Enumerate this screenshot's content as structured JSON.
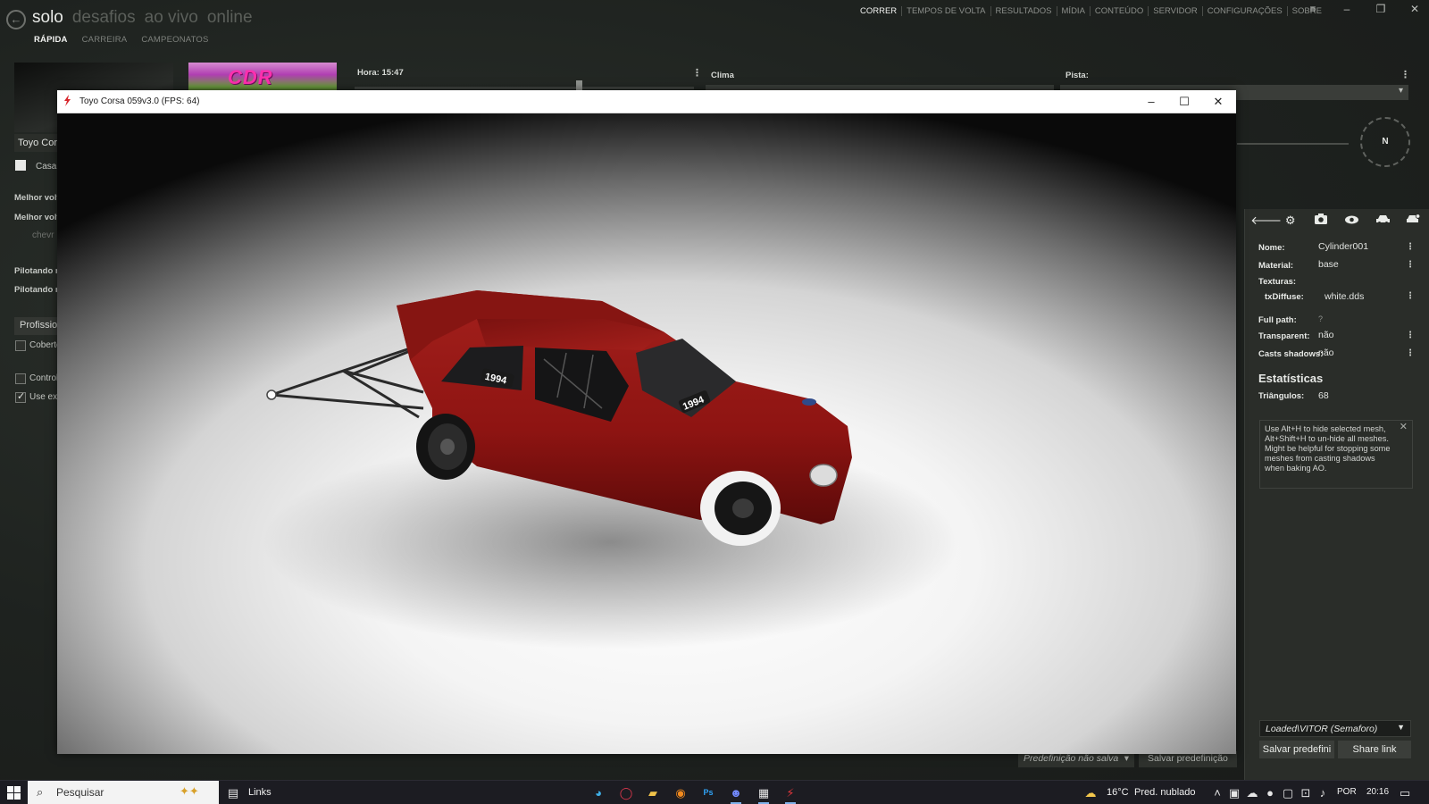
{
  "launcher": {
    "mode_tabs": [
      "solo",
      "desafios",
      "ao vivo",
      "online"
    ],
    "sub_tabs": [
      "RÁPIDA",
      "CARREIRA",
      "CAMPEONATOS"
    ],
    "top_nav": [
      "CORRER",
      "TEMPOS DE VOLTA",
      "RESULTADOS",
      "MÍDIA",
      "CONTEÚDO",
      "SERVIDOR",
      "CONFIGURAÇÕES",
      "SOBRE"
    ],
    "track_logo": "CDR",
    "time_label": "Hora: 15:47",
    "weather_label": "Clima",
    "track_label": "Pista:",
    "compass": "N",
    "car_name": "Toyo Cor",
    "skin_checkbox": "Casa",
    "best_lap_1": "Melhor volt",
    "best_lap_2": "Melhor volt",
    "car_dim": "chevr",
    "driving_1": "Pilotando n",
    "driving_2": "Pilotando n",
    "difficulty_btn": "Profissio",
    "covered_label": "Coberto",
    "controls_label": "Controle",
    "use_ext_label": "Use ext",
    "preset_status": "Predefinição não salva",
    "save_preset": "Salvar predefinição"
  },
  "viewer": {
    "title": "Toyo Corsa 059v3.0 (FPS: 64)",
    "car_decal": "1994",
    "colors": {
      "car_body": "#8e1412",
      "floor": "#ffffff"
    }
  },
  "inspector": {
    "fields": [
      {
        "label": "Nome:",
        "value": "Cylinder001"
      },
      {
        "label": "Material:",
        "value": "base"
      },
      {
        "label": "Texturas:",
        "value": ""
      },
      {
        "label": "txDiffuse:",
        "value": "white.dds"
      },
      {
        "label": "Full path:",
        "value": "?"
      },
      {
        "label": "Transparent:",
        "value": "não"
      },
      {
        "label": "Casts shadows:",
        "value": "não"
      }
    ],
    "stats_title": "Estatísticas",
    "triangles_label": "Triângulos:",
    "triangles_value": "68",
    "hint": "Use Alt+H to hide selected mesh, Alt+Shift+H to un-hide all meshes. Might be helpful for stopping some meshes from casting shadows when baking AO.",
    "preset_select": "Loaded\\VITOR (Semaforo)",
    "save_btn": "Salvar predefini",
    "share_btn": "Share link",
    "toolbar_icons": [
      "back-arrow-icon",
      "gear-icon",
      "camera-icon",
      "eye-icon",
      "car-icon",
      "car-settings-icon"
    ]
  },
  "taskbar": {
    "search_placeholder": "Pesquisar",
    "links_label": "Links",
    "weather_temp": "16°C",
    "weather_desc": "Pred. nublado",
    "language": "POR",
    "clock": "20:16"
  }
}
